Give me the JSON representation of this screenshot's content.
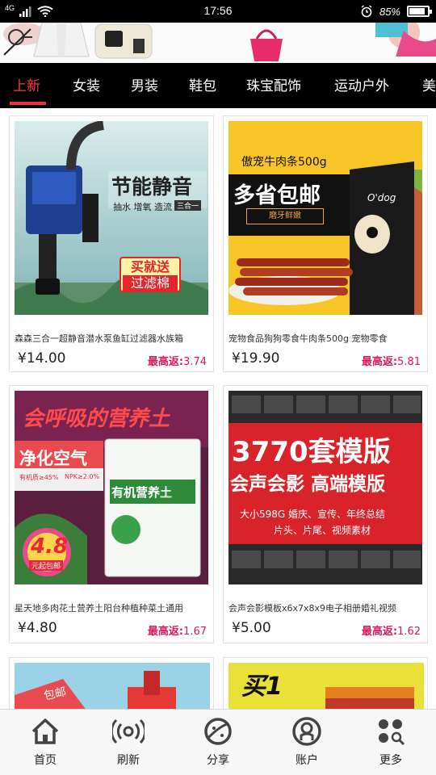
{
  "status_bar": {
    "network": "4G",
    "time": "17:56",
    "battery_percent": "85%",
    "battery_level": 0.85,
    "icons": [
      "signal-icon",
      "wifi-icon",
      "alarm-icon",
      "battery-icon"
    ]
  },
  "tabs": [
    {
      "label": "上新",
      "active": true
    },
    {
      "label": "女装",
      "active": false
    },
    {
      "label": "男装",
      "active": false
    },
    {
      "label": "鞋包",
      "active": false
    },
    {
      "label": "珠宝配饰",
      "active": false
    },
    {
      "label": "运动户外",
      "active": false
    },
    {
      "label": "美",
      "active": false
    }
  ],
  "colors": {
    "accent": "#e8333a",
    "rebate": "#d81b60",
    "tab_bar": "#000000"
  },
  "products": [
    {
      "title": "森森三合一超静音潜水泵鱼缸过滤器水族箱",
      "price": "¥14.00",
      "rebate_label": "最高返:",
      "rebate_value": "3.74",
      "image": {
        "headline": "节能静音",
        "sub": "抽水 增氧 造流",
        "badge": "三合一",
        "promo_top": "买就送",
        "promo_bottom": "过滤棉"
      }
    },
    {
      "title": "宠物食品狗狗零食牛肉条500g 宠物零食",
      "price": "¥19.90",
      "rebate_label": "最高返:",
      "rebate_value": "5.81",
      "image": {
        "headline_top": "傲宠牛肉条500g",
        "headline": "多省包邮",
        "button": "磨牙鲜嫩",
        "brand": "O'dog"
      }
    },
    {
      "title": "星天地多肉花土营养土阳台种植种菜土通用",
      "price": "¥4.80",
      "rebate_label": "最高返:",
      "rebate_value": "1.67",
      "image": {
        "headline": "会呼吸的营养土",
        "sub": "净化空气",
        "spec1": "有机质≥45%",
        "spec2": "NPK≥2.0%",
        "bag_label": "有机营养土",
        "price_tag": "4.8",
        "price_tag_sub": "元起包邮"
      }
    },
    {
      "title": "会声会影模板x6x7x8x9电子相册婚礼视频",
      "price": "¥5.00",
      "rebate_label": "最高返:",
      "rebate_value": "1.62",
      "image": {
        "headline": "3770套模版",
        "sub": "会声会影 高端模版",
        "line1": "大小598G  婚庆、宣传、年终总结",
        "line2": "片头、片尾、视频素材"
      }
    }
  ],
  "partial_cards": [
    {
      "image_text": "包邮"
    },
    {
      "image_text": "买1"
    }
  ],
  "bottom_nav": [
    {
      "label": "首页",
      "icon": "home-icon"
    },
    {
      "label": "刷新",
      "icon": "refresh-icon"
    },
    {
      "label": "分享",
      "icon": "share-icon"
    },
    {
      "label": "账户",
      "icon": "account-icon"
    },
    {
      "label": "更多",
      "icon": "more-icon"
    }
  ]
}
